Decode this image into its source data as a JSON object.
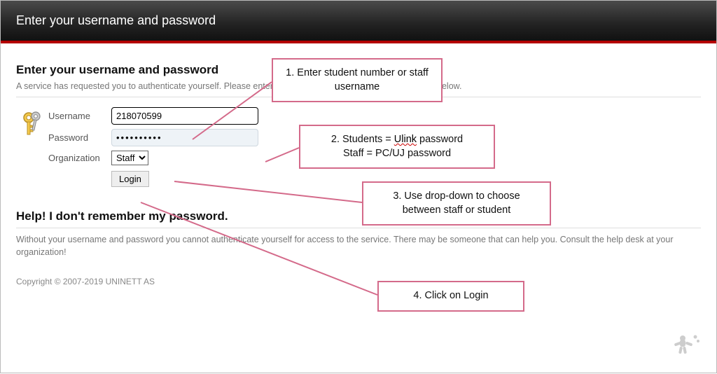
{
  "header": {
    "title": "Enter your username and password"
  },
  "main": {
    "heading": "Enter your username and password",
    "description": "A service has requested you to authenticate yourself. Please enter your username and password in the form below.",
    "labels": {
      "username": "Username",
      "password": "Password",
      "organization": "Organization"
    },
    "fields": {
      "username_value": "218070599",
      "password_value": "••••••••••",
      "org_selected": "Staff"
    },
    "login_label": "Login"
  },
  "help": {
    "heading": "Help! I don't remember my password.",
    "text": "Without your username and password you cannot authenticate yourself for access to the service. There may be someone that can help you. Consult the help desk at your organization!"
  },
  "footer": {
    "copyright": "Copyright © 2007-2019 UNINETT AS"
  },
  "callouts": {
    "c1": "1. Enter student number or staff username",
    "c2a": "2. Students = ",
    "c2b": "Ulink",
    "c2c": " password",
    "c2d": "Staff = PC/UJ password",
    "c3": "3. Use drop-down to choose between staff or student",
    "c4": "4. Click on Login"
  }
}
